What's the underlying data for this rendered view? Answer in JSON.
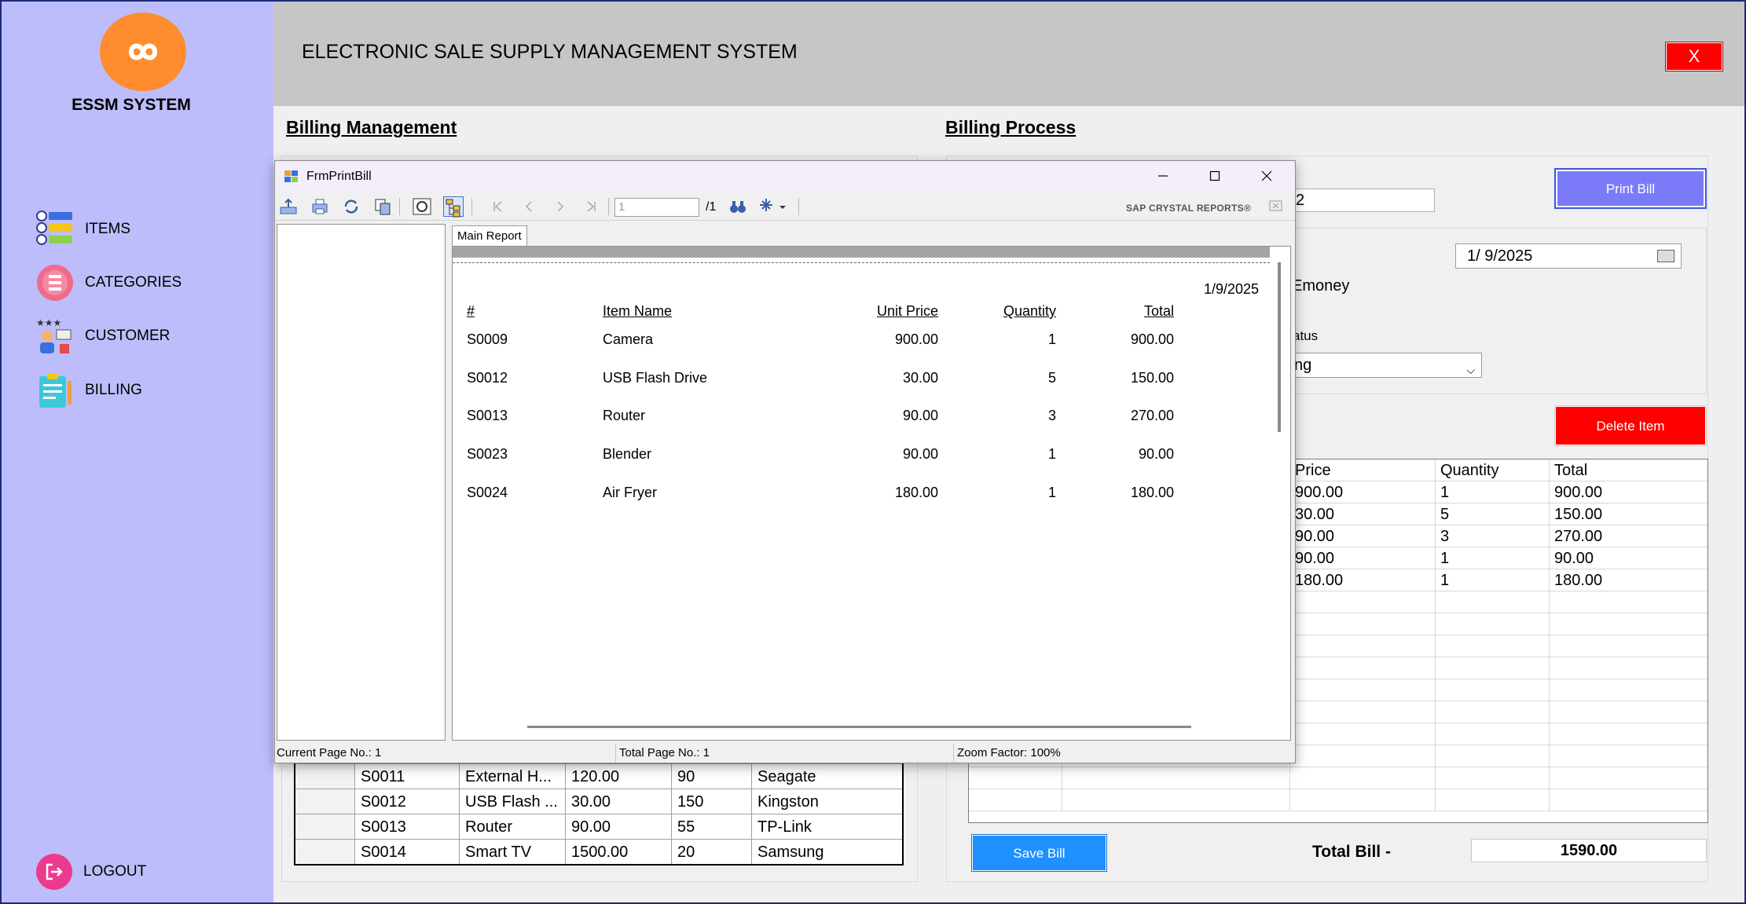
{
  "app": {
    "logo_text": "ESSM SYSTEM",
    "header_title": "ELECTRONIC SALE SUPPLY MANAGEMENT SYSTEM",
    "close_label": "X"
  },
  "sidebar": {
    "items": [
      {
        "label": "ITEMS",
        "icon": "list-icon"
      },
      {
        "label": "CATEGORIES",
        "icon": "categories-icon"
      },
      {
        "label": "CUSTOMER",
        "icon": "customer-icon"
      },
      {
        "label": "BILLING",
        "icon": "billing-icon"
      }
    ],
    "logout_label": "LOGOUT"
  },
  "billing_management": {
    "title": "Billing Management",
    "rows": [
      [
        "S0011",
        "External H...",
        "120.00",
        "90",
        "Seagate"
      ],
      [
        "S0012",
        "USB Flash ...",
        "30.00",
        "150",
        "Kingston"
      ],
      [
        "S0013",
        "Router",
        "90.00",
        "55",
        "TP-Link"
      ],
      [
        "S0014",
        "Smart TV",
        "1500.00",
        "20",
        "Samsung"
      ]
    ]
  },
  "billing_process": {
    "title": "Billing Process",
    "print_bill_label": "Print Bill",
    "partial_textbox_value": "2",
    "date_value": "1/  9/2025",
    "radio_emoney_label": "Emoney",
    "status_label": "atus",
    "status_value": "ng",
    "delete_item_label": "Delete Item",
    "grid_headers": [
      "Price",
      "Quantity",
      "Total"
    ],
    "grid_rows": [
      [
        "900.00",
        "1",
        "900.00"
      ],
      [
        "30.00",
        "5",
        "150.00"
      ],
      [
        "90.00",
        "3",
        "270.00"
      ],
      [
        "90.00",
        "1",
        "90.00"
      ],
      [
        "180.00",
        "1",
        "180.00"
      ]
    ],
    "save_bill_label": "Save Bill",
    "total_bill_label": "Total Bill -",
    "total_bill_value": "1590.00"
  },
  "print_dialog": {
    "title": "FrmPrintBill",
    "page_input": "1",
    "page_total": "/1",
    "brand": "SAP CRYSTAL REPORTS®",
    "tab_label": "Main Report",
    "report_date": "1/9/2025",
    "headers": [
      "#",
      "Item Name",
      "Unit Price",
      "Quantity",
      "Total"
    ],
    "rows": [
      [
        "S0009",
        "Camera",
        "900.00",
        "1",
        "900.00"
      ],
      [
        "S0012",
        "USB Flash Drive",
        "30.00",
        "5",
        "150.00"
      ],
      [
        "S0013",
        "Router",
        "90.00",
        "3",
        "270.00"
      ],
      [
        "S0023",
        "Blender",
        "90.00",
        "1",
        "90.00"
      ],
      [
        "S0024",
        "Air Fryer",
        "180.00",
        "1",
        "180.00"
      ]
    ],
    "status": {
      "current_page": "Current Page No.: 1",
      "total_page": "Total Page No.: 1",
      "zoom": "Zoom Factor: 100%"
    }
  },
  "colors": {
    "sidebar_bg": "#bdbdfb",
    "header_bg": "#c6c6c6",
    "print_bill": "#7b7bfa",
    "delete_item": "#ff0000",
    "save_bill": "#1e90ff",
    "logo": "#ff8c2e"
  }
}
